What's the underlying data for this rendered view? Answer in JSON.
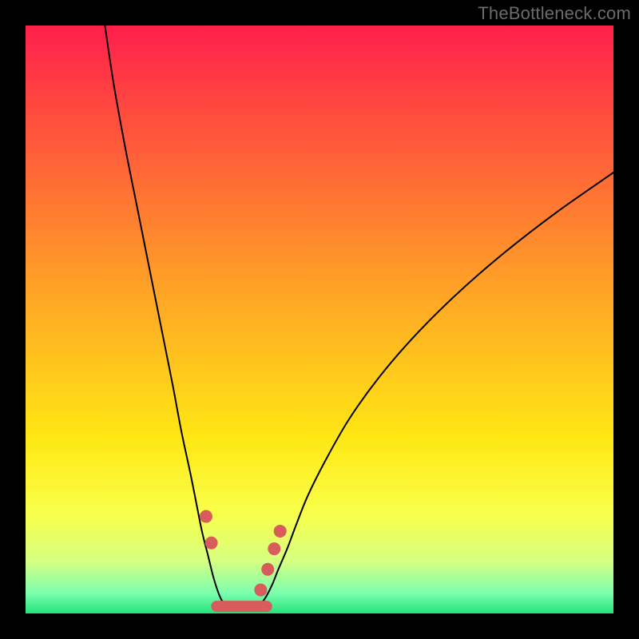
{
  "watermark": "TheBottleneck.com",
  "chart_data": {
    "type": "line",
    "title": "",
    "xlabel": "",
    "ylabel": "",
    "xlim": [
      0,
      100
    ],
    "ylim": [
      0,
      100
    ],
    "grid": false,
    "legend": false,
    "background_gradient": [
      {
        "offset": 0.0,
        "color": "#ff1f4b"
      },
      {
        "offset": 0.45,
        "color": "#ffa326"
      },
      {
        "offset": 0.7,
        "color": "#ffe714"
      },
      {
        "offset": 0.83,
        "color": "#f8ff4a"
      },
      {
        "offset": 0.91,
        "color": "#d7ff80"
      },
      {
        "offset": 0.965,
        "color": "#7cffb0"
      },
      {
        "offset": 1.0,
        "color": "#24e37a"
      }
    ],
    "series": [
      {
        "name": "left-branch",
        "stroke": "#000000",
        "stroke_width": 2,
        "x": [
          13.5,
          15,
          17,
          19,
          21,
          23,
          25,
          26.5,
          28,
          29,
          30,
          31,
          32,
          33,
          33.8
        ],
        "y": [
          100,
          90,
          79,
          69,
          59,
          49,
          39,
          31,
          24,
          19,
          14,
          10,
          6,
          3,
          1.5
        ]
      },
      {
        "name": "right-branch",
        "stroke": "#000000",
        "stroke_width": 2,
        "x": [
          40,
          41,
          42,
          43,
          44.5,
          46,
          48,
          51,
          55,
          60,
          66,
          73,
          81,
          90,
          100
        ],
        "y": [
          1.5,
          3,
          5,
          7.5,
          11,
          15,
          20,
          26,
          33,
          40,
          47,
          54,
          61,
          68,
          75
        ]
      },
      {
        "name": "valley-floor",
        "stroke": "#000000",
        "stroke_width": 2,
        "x": [
          33.8,
          35,
          36.5,
          38,
          40
        ],
        "y": [
          1.5,
          1.0,
          0.9,
          1.0,
          1.5
        ]
      }
    ],
    "markers": [
      {
        "name": "left-upper-dot",
        "x": 30.7,
        "y": 16.5,
        "r": 8,
        "color": "#d85c5c"
      },
      {
        "name": "left-lower-dot",
        "x": 31.6,
        "y": 12.0,
        "r": 8,
        "color": "#d85c5c"
      },
      {
        "name": "right-dot-1",
        "x": 40.0,
        "y": 4.0,
        "r": 8,
        "color": "#d85c5c"
      },
      {
        "name": "right-dot-2",
        "x": 41.2,
        "y": 7.5,
        "r": 8,
        "color": "#d85c5c"
      },
      {
        "name": "right-dot-3",
        "x": 42.3,
        "y": 11.0,
        "r": 8,
        "color": "#d85c5c"
      },
      {
        "name": "right-dot-4",
        "x": 43.3,
        "y": 14.0,
        "r": 8,
        "color": "#d85c5c"
      }
    ],
    "floor_segment": {
      "name": "valley-band",
      "x1": 32.5,
      "x2": 41.0,
      "y": 1.2,
      "thickness": 14,
      "color": "#d85c5c"
    }
  },
  "colors": {
    "frame": "#000000",
    "watermark": "#6b6b6b",
    "curve": "#000000",
    "marker": "#d85c5c"
  }
}
